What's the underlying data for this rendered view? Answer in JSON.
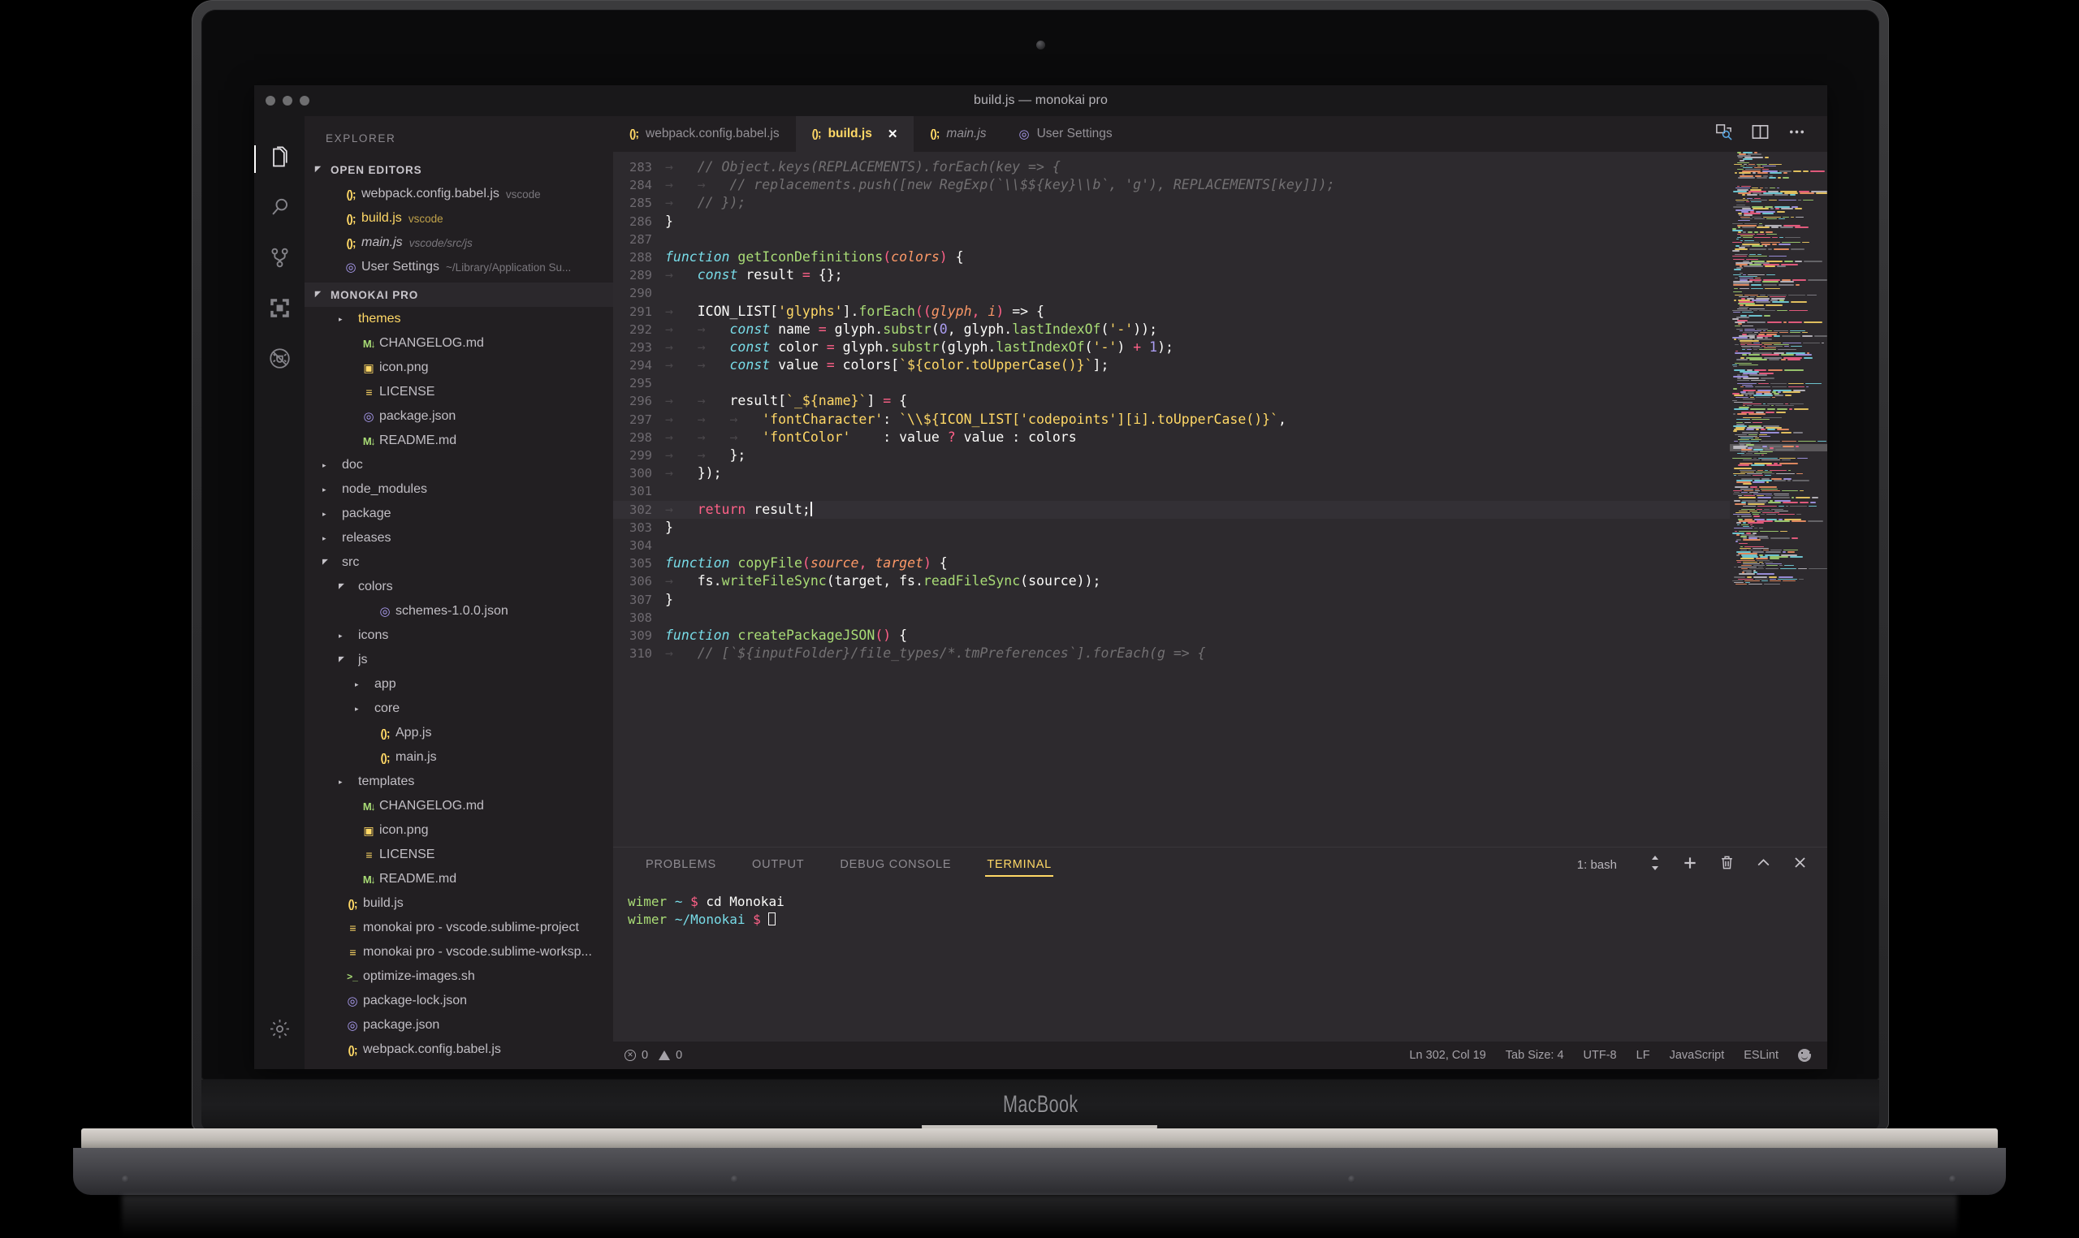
{
  "device": {
    "brand_label": "MacBook"
  },
  "window": {
    "title": "build.js — monokai pro"
  },
  "activity_bar": {
    "items": [
      {
        "name": "explorer",
        "icon": "files-icon",
        "active": true
      },
      {
        "name": "search",
        "icon": "search-icon",
        "active": false
      },
      {
        "name": "source-control",
        "icon": "source-control-icon",
        "active": false
      },
      {
        "name": "extensions",
        "icon": "extensions-icon",
        "active": false
      },
      {
        "name": "debug",
        "icon": "debug-disabled-icon",
        "active": false
      },
      {
        "name": "settings",
        "icon": "gear-icon",
        "active": false
      }
    ]
  },
  "sidebar": {
    "title": "EXPLORER",
    "open_editors": {
      "label": "OPEN EDITORS",
      "items": [
        {
          "icon": "js-icon",
          "name": "webpack.config.babel.js",
          "sub": "vscode",
          "selected": false,
          "italic": false
        },
        {
          "icon": "js-icon",
          "name": "build.js",
          "sub": "vscode",
          "selected": true,
          "italic": false
        },
        {
          "icon": "js-icon",
          "name": "main.js",
          "sub": "vscode/src/js",
          "selected": false,
          "italic": true
        },
        {
          "icon": "json-icon",
          "name": "User Settings",
          "sub": "~/Library/Application Su...",
          "selected": false,
          "italic": false
        }
      ]
    },
    "project": {
      "label": "MONOKAI PRO",
      "items": [
        {
          "icon": "folder-icon",
          "name": "themes",
          "depth": 1,
          "state": "closed",
          "selected": true
        },
        {
          "icon": "md-icon",
          "name": "CHANGELOG.md",
          "depth": 1,
          "state": "file"
        },
        {
          "icon": "png-icon",
          "name": "icon.png",
          "depth": 1,
          "state": "file"
        },
        {
          "icon": "license-icon",
          "name": "LICENSE",
          "depth": 1,
          "state": "file"
        },
        {
          "icon": "json-icon",
          "name": "package.json",
          "depth": 1,
          "state": "file"
        },
        {
          "icon": "md-icon",
          "name": "README.md",
          "depth": 1,
          "state": "file"
        },
        {
          "icon": "folder-icon",
          "name": "doc",
          "depth": 0,
          "state": "closed"
        },
        {
          "icon": "folder-icon",
          "name": "node_modules",
          "depth": 0,
          "state": "closed"
        },
        {
          "icon": "folder-icon",
          "name": "package",
          "depth": 0,
          "state": "closed"
        },
        {
          "icon": "folder-icon",
          "name": "releases",
          "depth": 0,
          "state": "closed"
        },
        {
          "icon": "folder-icon",
          "name": "src",
          "depth": 0,
          "state": "open"
        },
        {
          "icon": "folder-icon",
          "name": "colors",
          "depth": 1,
          "state": "open"
        },
        {
          "icon": "json-icon",
          "name": "schemes-1.0.0.json",
          "depth": 2,
          "state": "file"
        },
        {
          "icon": "folder-icon",
          "name": "icons",
          "depth": 1,
          "state": "closed"
        },
        {
          "icon": "folder-icon",
          "name": "js",
          "depth": 1,
          "state": "open"
        },
        {
          "icon": "folder-icon",
          "name": "app",
          "depth": 2,
          "state": "closed"
        },
        {
          "icon": "folder-icon",
          "name": "core",
          "depth": 2,
          "state": "closed"
        },
        {
          "icon": "js-icon",
          "name": "App.js",
          "depth": 2,
          "state": "file"
        },
        {
          "icon": "js-icon",
          "name": "main.js",
          "depth": 2,
          "state": "file"
        },
        {
          "icon": "folder-icon",
          "name": "templates",
          "depth": 1,
          "state": "closed"
        },
        {
          "icon": "md-icon",
          "name": "CHANGELOG.md",
          "depth": 1,
          "state": "file"
        },
        {
          "icon": "png-icon",
          "name": "icon.png",
          "depth": 1,
          "state": "file"
        },
        {
          "icon": "license-icon",
          "name": "LICENSE",
          "depth": 1,
          "state": "file"
        },
        {
          "icon": "md-icon",
          "name": "README.md",
          "depth": 1,
          "state": "file"
        },
        {
          "icon": "js-icon",
          "name": "build.js",
          "depth": 0,
          "state": "file"
        },
        {
          "icon": "license-icon",
          "name": "monokai pro - vscode.sublime-project",
          "depth": 0,
          "state": "file"
        },
        {
          "icon": "license-icon",
          "name": "monokai pro - vscode.sublime-worksp...",
          "depth": 0,
          "state": "file"
        },
        {
          "icon": "sh-icon",
          "name": "optimize-images.sh",
          "depth": 0,
          "state": "file"
        },
        {
          "icon": "json-icon",
          "name": "package-lock.json",
          "depth": 0,
          "state": "file"
        },
        {
          "icon": "json-icon",
          "name": "package.json",
          "depth": 0,
          "state": "file"
        },
        {
          "icon": "js-icon",
          "name": "webpack.config.babel.js",
          "depth": 0,
          "state": "file"
        }
      ]
    }
  },
  "editor": {
    "tabs": [
      {
        "icon": "js-icon",
        "label": "webpack.config.babel.js",
        "active": false,
        "italic": false,
        "closable": false
      },
      {
        "icon": "js-icon",
        "label": "build.js",
        "active": true,
        "italic": false,
        "closable": true
      },
      {
        "icon": "js-icon",
        "label": "main.js",
        "active": false,
        "italic": true,
        "closable": false
      },
      {
        "icon": "json-icon",
        "label": "User Settings",
        "active": false,
        "italic": false,
        "closable": false
      }
    ],
    "close_glyph": "✕",
    "actions": [
      {
        "name": "split-editor-icon"
      },
      {
        "name": "open-preview-icon"
      },
      {
        "name": "more-actions-icon"
      }
    ],
    "first_line_number": 283,
    "highlight_line": 302,
    "lines": [
      {
        "n": 283,
        "tokens": [
          {
            "t": "ind",
            "v": "→   "
          },
          {
            "t": "cmt",
            "v": "// Object.keys(REPLACEMENTS).forEach(key => {"
          }
        ]
      },
      {
        "n": 284,
        "tokens": [
          {
            "t": "ind",
            "v": "→   →   "
          },
          {
            "t": "cmt",
            "v": "// replacements.push([new RegExp(`\\\\$${key}\\\\b`, 'g'), REPLACEMENTS[key]]);"
          }
        ]
      },
      {
        "n": 285,
        "tokens": [
          {
            "t": "ind",
            "v": "→   "
          },
          {
            "t": "cmt",
            "v": "// });"
          }
        ]
      },
      {
        "n": 286,
        "tokens": [
          {
            "t": "var",
            "v": "}"
          }
        ]
      },
      {
        "n": 287,
        "tokens": []
      },
      {
        "n": 288,
        "tokens": [
          {
            "t": "kw2",
            "v": "function"
          },
          {
            "t": "var",
            "v": " "
          },
          {
            "t": "fn",
            "v": "getIconDefinitions"
          },
          {
            "t": "op",
            "v": "("
          },
          {
            "t": "par",
            "v": "colors"
          },
          {
            "t": "op",
            "v": ")"
          },
          {
            "t": "var",
            "v": " {"
          }
        ]
      },
      {
        "n": 289,
        "tokens": [
          {
            "t": "ind",
            "v": "→   "
          },
          {
            "t": "kw2",
            "v": "const"
          },
          {
            "t": "var",
            "v": " result "
          },
          {
            "t": "op",
            "v": "="
          },
          {
            "t": "var",
            "v": " {};"
          }
        ]
      },
      {
        "n": 290,
        "tokens": []
      },
      {
        "n": 291,
        "tokens": [
          {
            "t": "ind",
            "v": "→   "
          },
          {
            "t": "var",
            "v": "ICON_LIST["
          },
          {
            "t": "str",
            "v": "'glyphs'"
          },
          {
            "t": "var",
            "v": "]."
          },
          {
            "t": "fn",
            "v": "forEach"
          },
          {
            "t": "op",
            "v": "(("
          },
          {
            "t": "par",
            "v": "glyph"
          },
          {
            "t": "op",
            "v": ", "
          },
          {
            "t": "par",
            "v": "i"
          },
          {
            "t": "op",
            "v": ")"
          },
          {
            "t": "var",
            "v": " => {"
          }
        ]
      },
      {
        "n": 292,
        "tokens": [
          {
            "t": "ind",
            "v": "→   →   "
          },
          {
            "t": "kw2",
            "v": "const"
          },
          {
            "t": "var",
            "v": " name "
          },
          {
            "t": "op",
            "v": "="
          },
          {
            "t": "var",
            "v": " glyph."
          },
          {
            "t": "fn",
            "v": "substr"
          },
          {
            "t": "var",
            "v": "("
          },
          {
            "t": "num",
            "v": "0"
          },
          {
            "t": "var",
            "v": ", glyph."
          },
          {
            "t": "fn",
            "v": "lastIndexOf"
          },
          {
            "t": "var",
            "v": "("
          },
          {
            "t": "str",
            "v": "'-'"
          },
          {
            "t": "var",
            "v": "));"
          }
        ]
      },
      {
        "n": 293,
        "tokens": [
          {
            "t": "ind",
            "v": "→   →   "
          },
          {
            "t": "kw2",
            "v": "const"
          },
          {
            "t": "var",
            "v": " color "
          },
          {
            "t": "op",
            "v": "="
          },
          {
            "t": "var",
            "v": " glyph."
          },
          {
            "t": "fn",
            "v": "substr"
          },
          {
            "t": "var",
            "v": "(glyph."
          },
          {
            "t": "fn",
            "v": "lastIndexOf"
          },
          {
            "t": "var",
            "v": "("
          },
          {
            "t": "str",
            "v": "'-'"
          },
          {
            "t": "var",
            "v": ") "
          },
          {
            "t": "op",
            "v": "+"
          },
          {
            "t": "var",
            "v": " "
          },
          {
            "t": "num",
            "v": "1"
          },
          {
            "t": "var",
            "v": ");"
          }
        ]
      },
      {
        "n": 294,
        "tokens": [
          {
            "t": "ind",
            "v": "→   →   "
          },
          {
            "t": "kw2",
            "v": "const"
          },
          {
            "t": "var",
            "v": " value "
          },
          {
            "t": "op",
            "v": "="
          },
          {
            "t": "var",
            "v": " colors["
          },
          {
            "t": "str",
            "v": "`${color.toUpperCase()}`"
          },
          {
            "t": "var",
            "v": "];"
          }
        ]
      },
      {
        "n": 295,
        "tokens": []
      },
      {
        "n": 296,
        "tokens": [
          {
            "t": "ind",
            "v": "→   →   "
          },
          {
            "t": "var",
            "v": "result["
          },
          {
            "t": "str",
            "v": "`_${name}`"
          },
          {
            "t": "var",
            "v": "] "
          },
          {
            "t": "op",
            "v": "="
          },
          {
            "t": "var",
            "v": " {"
          }
        ]
      },
      {
        "n": 297,
        "tokens": [
          {
            "t": "ind",
            "v": "→   →   →   "
          },
          {
            "t": "str",
            "v": "'fontCharacter'"
          },
          {
            "t": "var",
            "v": ": "
          },
          {
            "t": "str",
            "v": "`\\\\${ICON_LIST['codepoints'][i].toUpperCase()}`"
          },
          {
            "t": "var",
            "v": ","
          }
        ]
      },
      {
        "n": 298,
        "tokens": [
          {
            "t": "ind",
            "v": "→   →   →   "
          },
          {
            "t": "str",
            "v": "'fontColor'"
          },
          {
            "t": "ind",
            "v": "    "
          },
          {
            "t": "var",
            "v": ": value "
          },
          {
            "t": "op",
            "v": "?"
          },
          {
            "t": "var",
            "v": " value : colors"
          }
        ]
      },
      {
        "n": 299,
        "tokens": [
          {
            "t": "ind",
            "v": "→   →   "
          },
          {
            "t": "var",
            "v": "};"
          }
        ]
      },
      {
        "n": 300,
        "tokens": [
          {
            "t": "ind",
            "v": "→   "
          },
          {
            "t": "var",
            "v": "});"
          }
        ]
      },
      {
        "n": 301,
        "tokens": []
      },
      {
        "n": 302,
        "tokens": [
          {
            "t": "ind",
            "v": "→   "
          },
          {
            "t": "kw",
            "v": "return"
          },
          {
            "t": "var",
            "v": " result;"
          },
          {
            "t": "caret",
            "v": ""
          }
        ]
      },
      {
        "n": 303,
        "tokens": [
          {
            "t": "var",
            "v": "}"
          }
        ]
      },
      {
        "n": 304,
        "tokens": []
      },
      {
        "n": 305,
        "tokens": [
          {
            "t": "kw2",
            "v": "function"
          },
          {
            "t": "var",
            "v": " "
          },
          {
            "t": "fn",
            "v": "copyFile"
          },
          {
            "t": "op",
            "v": "("
          },
          {
            "t": "par",
            "v": "source"
          },
          {
            "t": "op",
            "v": ", "
          },
          {
            "t": "par",
            "v": "target"
          },
          {
            "t": "op",
            "v": ")"
          },
          {
            "t": "var",
            "v": " {"
          }
        ]
      },
      {
        "n": 306,
        "tokens": [
          {
            "t": "ind",
            "v": "→   "
          },
          {
            "t": "var",
            "v": "fs."
          },
          {
            "t": "fn",
            "v": "writeFileSync"
          },
          {
            "t": "var",
            "v": "(target, fs."
          },
          {
            "t": "fn",
            "v": "readFileSync"
          },
          {
            "t": "var",
            "v": "(source));"
          }
        ]
      },
      {
        "n": 307,
        "tokens": [
          {
            "t": "var",
            "v": "}"
          }
        ]
      },
      {
        "n": 308,
        "tokens": []
      },
      {
        "n": 309,
        "tokens": [
          {
            "t": "kw2",
            "v": "function"
          },
          {
            "t": "var",
            "v": " "
          },
          {
            "t": "fn",
            "v": "createPackageJSON"
          },
          {
            "t": "op",
            "v": "()"
          },
          {
            "t": "var",
            "v": " {"
          }
        ]
      },
      {
        "n": 310,
        "tokens": [
          {
            "t": "ind",
            "v": "→   "
          },
          {
            "t": "cmt",
            "v": "// [`${inputFolder}/file_types/*.tmPreferences`].forEach(g => {"
          }
        ]
      }
    ]
  },
  "panel": {
    "tabs": [
      {
        "label": "PROBLEMS",
        "active": false
      },
      {
        "label": "OUTPUT",
        "active": false
      },
      {
        "label": "DEBUG CONSOLE",
        "active": false
      },
      {
        "label": "TERMINAL",
        "active": true
      }
    ],
    "shell_selector": "1: bash",
    "actions": [
      {
        "name": "split-terminal-icon"
      },
      {
        "name": "new-terminal-icon"
      },
      {
        "name": "kill-terminal-icon"
      },
      {
        "name": "maximize-panel-icon"
      },
      {
        "name": "close-panel-icon"
      }
    ],
    "terminal_lines": [
      {
        "user": "wimer",
        "path": "~",
        "prompt": "$",
        "command": "cd Monokai",
        "caret": false
      },
      {
        "user": "wimer",
        "path": "~/Monokai",
        "prompt": "$",
        "command": "",
        "caret": true
      }
    ]
  },
  "status_bar": {
    "errors": "0",
    "warnings": "0",
    "right_items": [
      {
        "name": "cursor-position",
        "label": "Ln 302, Col 19"
      },
      {
        "name": "tab-size",
        "label": "Tab Size: 4"
      },
      {
        "name": "encoding",
        "label": "UTF-8"
      },
      {
        "name": "eol",
        "label": "LF"
      },
      {
        "name": "language-mode",
        "label": "JavaScript"
      },
      {
        "name": "eslint-status",
        "label": "ESLint"
      }
    ]
  },
  "theme_colors": {
    "editor_bg": "#2d2a2e",
    "sidebar_bg": "#221f22",
    "activitybar_bg": "#19181a",
    "accent_yellow": "#ffd866",
    "green": "#a9dc76",
    "pink": "#ff6188",
    "purple": "#ab9df2",
    "cyan": "#78dce8",
    "orange": "#fc9867",
    "comment": "#727072",
    "foreground": "#fcfcfa"
  }
}
